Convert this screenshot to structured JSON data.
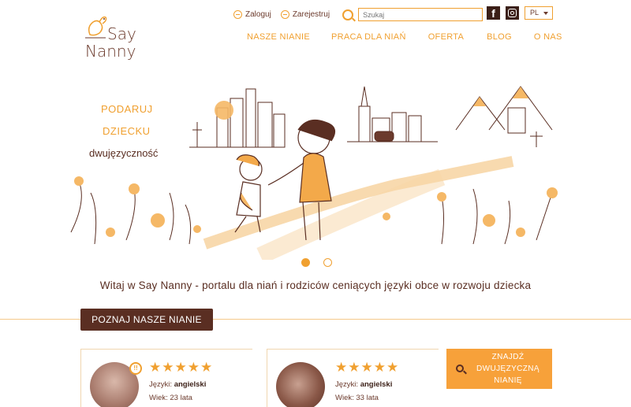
{
  "brand": {
    "line1": "Say",
    "line2": "Nanny",
    "accent": "#f0a030",
    "dark": "#5a2e22"
  },
  "top": {
    "login_label": "Zaloguj",
    "register_label": "Zarejestruj",
    "search_placeholder": "Szukaj",
    "lang_selected": "PL",
    "facebook_glyph": "f"
  },
  "nav": [
    "NASZE NIANIE",
    "PRACA DLA NIAŃ",
    "OFERTA",
    "BLOG",
    "O NAS"
  ],
  "hero": {
    "tag1": "PODARUJ",
    "tag2": "DZIECKU",
    "tag3": "dwujęzyczność",
    "slides_total": 2,
    "slide_active": 1
  },
  "welcome_text": "Witaj w Say Nanny - portalu dla nianь i rodziców ceniących języki obce w rozwoju dziecka",
  "cta_meet": "POZNAJ NASZE NIANIE",
  "cards": [
    {
      "rating": 5,
      "languages_label": "Języki:",
      "languages": "angielski",
      "age_label": "Wiek:",
      "age": "23 lata",
      "badge": "!!"
    },
    {
      "rating": 5,
      "languages_label": "Języki:",
      "languages": "angielski",
      "age_label": "Wiek:",
      "age": "33 lata"
    }
  ],
  "cta_find": "ZNAJDŹ DWUJĘZYCZNĄ NIANIĘ"
}
